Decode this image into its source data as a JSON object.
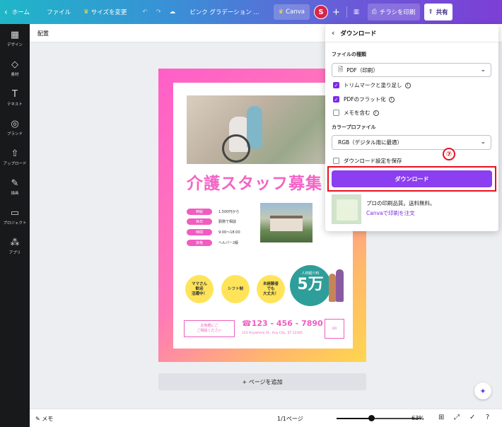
{
  "topbar": {
    "back_icon": "chevron-left-icon",
    "home": "ホーム",
    "file": "ファイル",
    "resize": "サイズを変更",
    "title": "ピンク グラデーション ...",
    "canva_pro": "Canva",
    "avatar": "S",
    "add": "+",
    "print": "チラシを印刷",
    "share": "共有"
  },
  "rail": {
    "items": [
      {
        "icon": "▦",
        "label": "デザイン"
      },
      {
        "icon": "◇",
        "label": "素材"
      },
      {
        "icon": "T",
        "label": "テキスト"
      },
      {
        "icon": "◎",
        "label": "ブランド"
      },
      {
        "icon": "⇧",
        "label": "アップロード"
      },
      {
        "icon": "✎",
        "label": "描画"
      },
      {
        "icon": "▭",
        "label": "プロジェクト"
      },
      {
        "icon": "⁂",
        "label": "アプリ"
      }
    ]
  },
  "subbar": {
    "label": "配置"
  },
  "design": {
    "headline": "介護スタッフ募集",
    "rows": [
      {
        "pill": "時給",
        "value": "1,500円から"
      },
      {
        "pill": "休日",
        "value": "勤務で相談"
      },
      {
        "pill": "時間",
        "value": "9:00～18:00"
      },
      {
        "pill": "資格",
        "value": "ヘルパー2級"
      }
    ],
    "badges": [
      "ママさん\n歓迎\n活躍中！",
      "シフト制",
      "未経験者\nでも\n大丈夫！"
    ],
    "teal_small": "人材紹介料",
    "teal_big": "5万",
    "footer_box": "お気軽にご\nご相談ください",
    "phone": "☎123 - 456 - 7890",
    "address": "123 Anywhere St., Any City, ST 12345",
    "qr": "QR"
  },
  "add_page": "+ ページを追加",
  "bottombar": {
    "memo": "メモ",
    "pages": "1/1ページ",
    "zoom": "63%",
    "zoom_fraction": 0.63
  },
  "panel": {
    "title": "ダウンロード",
    "file_type_label": "ファイルの種類",
    "file_type_value": "PDF（印刷）",
    "checks": [
      {
        "label": "トリムマークと塗り足し",
        "checked": true,
        "info": true
      },
      {
        "label": "PDFのフラット化",
        "checked": true,
        "info": true
      },
      {
        "label": "メモを含む",
        "checked": false,
        "info": true
      }
    ],
    "color_label": "カラープロファイル",
    "color_value": "RGB（デジタル用に最適）",
    "save_settings": "ダウンロード設定を保存",
    "download_button": "ダウンロード",
    "promo_text": "プロの印刷品質。送料無料。",
    "promo_link": "Canvaで印刷を注文"
  },
  "annotation": {
    "number": "⑦"
  },
  "colors": {
    "accent": "#8b3ff0",
    "annotation": "#e81020",
    "headline": "#f265c6"
  }
}
